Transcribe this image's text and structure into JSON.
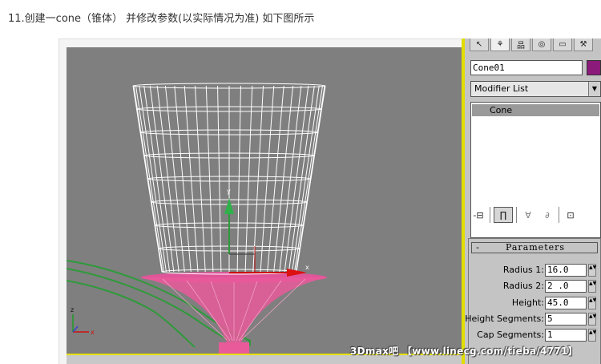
{
  "caption": "11.创建一cone（锥体） 并修改参数(以实际情况为准) 如下图所示",
  "viewport": {
    "axis_y_label": "y",
    "axis_x_label": "x",
    "corner_axis_z": "z",
    "corner_axis_x": "x"
  },
  "command_panel": {
    "tabs": [
      {
        "icon": "create-icon",
        "glyph": "↖"
      },
      {
        "icon": "modify-icon",
        "glyph": "⚘"
      },
      {
        "icon": "hierarchy-icon",
        "glyph": "品"
      },
      {
        "icon": "motion-icon",
        "glyph": "◎"
      },
      {
        "icon": "display-icon",
        "glyph": "▭"
      },
      {
        "icon": "utilities-icon",
        "glyph": "⚒"
      }
    ],
    "object_name": "Cone01",
    "object_color": "#8c1a7a",
    "modifier_list": {
      "selected": "Modifier List",
      "arrow": "▼"
    },
    "modifier_stack": [
      {
        "label": "Cone"
      }
    ],
    "stack_tools": {
      "pin": "-⊟",
      "show_end_result": "∏",
      "make_unique": "∀",
      "remove_modifier": "∂",
      "configure": "⊡"
    }
  },
  "parameters": {
    "collapse": "-",
    "title": "Parameters",
    "spinner_glyph": "▲▼",
    "rows": [
      {
        "label": "Radius 1:",
        "value": "16.0"
      },
      {
        "label": "Radius 2:",
        "value": "2 .0"
      },
      {
        "label": "Height:",
        "value": "45.0"
      },
      {
        "label": "Height Segments:",
        "value": "5"
      },
      {
        "label": "Cap Segments:",
        "value": "1"
      }
    ]
  },
  "watermark": "3Dmax吧 【www.linecg.com/tieba/4771】",
  "colors": {
    "viewport_bg": "#7f7f7f",
    "wireframe": "#ffffff",
    "pink_object": "#e85a9a",
    "green_object": "#2e9a3a",
    "highlight_border": "#e2dd00"
  }
}
